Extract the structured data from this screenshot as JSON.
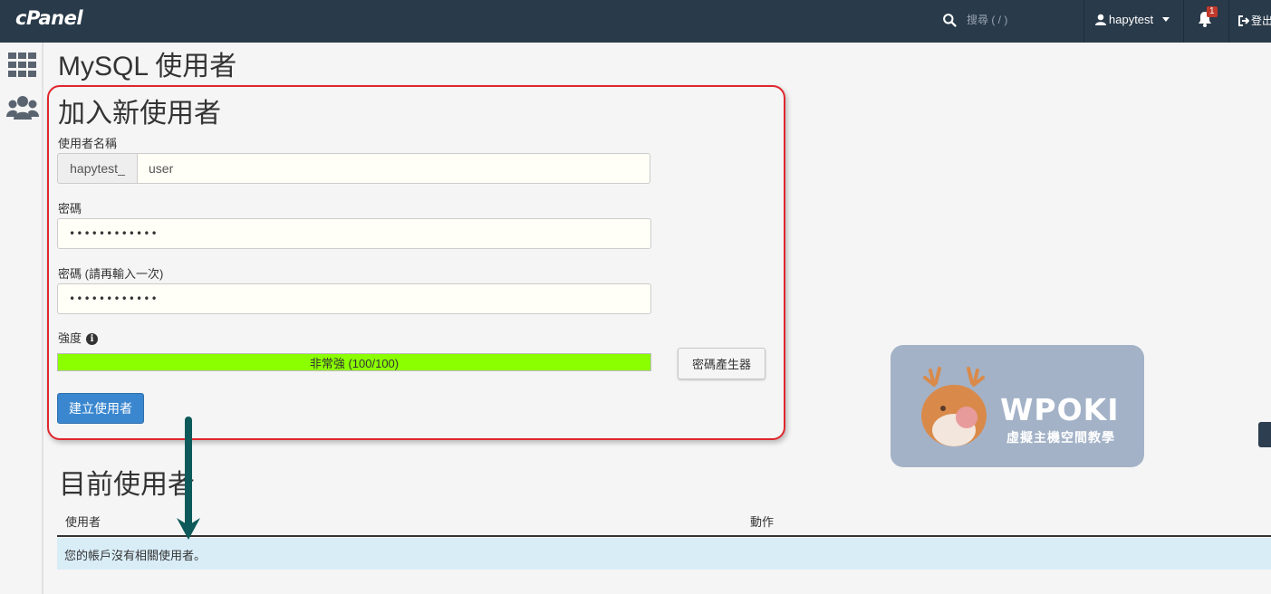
{
  "topbar": {
    "logo": "cPanel",
    "search_placeholder": "搜尋 ( / )",
    "username": "hapytest",
    "notification_count": "1",
    "logout_label": "登出"
  },
  "sidebar": {
    "items": [
      {
        "icon": "grid-icon"
      },
      {
        "icon": "users-icon"
      }
    ]
  },
  "page": {
    "title": "MySQL 使用者"
  },
  "add_user": {
    "section_title": "加入新使用者",
    "username_label": "使用者名稱",
    "username_prefix": "hapytest_",
    "username_value": "user",
    "password_label": "密碼",
    "password_value": "••••••••••••",
    "password_again_label": "密碼 (請再輸入一次)",
    "password_again_value": "••••••••••••",
    "strength_label": "強度",
    "strength_text": "非常強 (100/100)",
    "strength_percent": 100,
    "generator_button": "密碼產生器",
    "create_button": "建立使用者"
  },
  "current_users": {
    "title": "目前使用者",
    "columns": [
      "使用者",
      "動作"
    ],
    "empty_message": "您的帳戶沒有相關使用者。"
  },
  "watermark": {
    "brand": "WPOKI",
    "tagline": "虛擬主機空間教學"
  },
  "colors": {
    "topbar": "#293a4a",
    "highlight_border": "#e0262d",
    "strength_fill": "#8bff00",
    "primary_button": "#3a87cf",
    "empty_row": "#d9edf7",
    "arrow": "#0e5a5a"
  }
}
